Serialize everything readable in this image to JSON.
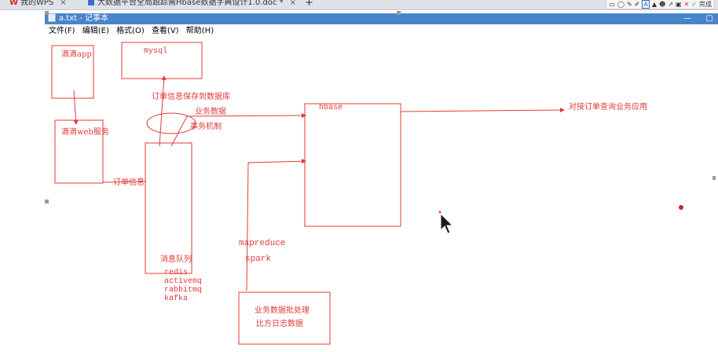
{
  "tabs": [
    {
      "label": "我的WPS",
      "close": "×"
    },
    {
      "label": "大数据平台全局跟踪需Hbase数据字典设计1.0.doc *",
      "close": "×"
    }
  ],
  "new_tab": "+",
  "toolbar": {
    "done_label": "完成"
  },
  "window": {
    "title": "a.txt - 记事本",
    "minimize": "—",
    "restore": "▢"
  },
  "menu": [
    "文件(F)",
    "编辑(E)",
    "格式(O)",
    "查看(V)",
    "帮助(H)"
  ],
  "diagram": {
    "didi_app": "滴滴app",
    "mysql": "mysql",
    "didi_web": "滴滴web服务",
    "order_info": "订单信息",
    "save_label": "订单信息保存到数据库",
    "business_data": "业务数据",
    "transaction": "事务机制",
    "hbase": "hbase",
    "query_app": "对接订单查询业务应用",
    "mq_title": "消息队列",
    "mq_redis": "redis",
    "mq_activemq": "activemq",
    "mq_rabbitmq": "rabbitmq",
    "mq_kafka": "kafka",
    "mapreduce": "mapreduce",
    "spark": "spark",
    "batch_line1": "业务数据批处理",
    "batch_line2": "比方日志数据"
  },
  "colors": {
    "ink": "#e03a3a",
    "titlebar": "#4a84c9"
  }
}
